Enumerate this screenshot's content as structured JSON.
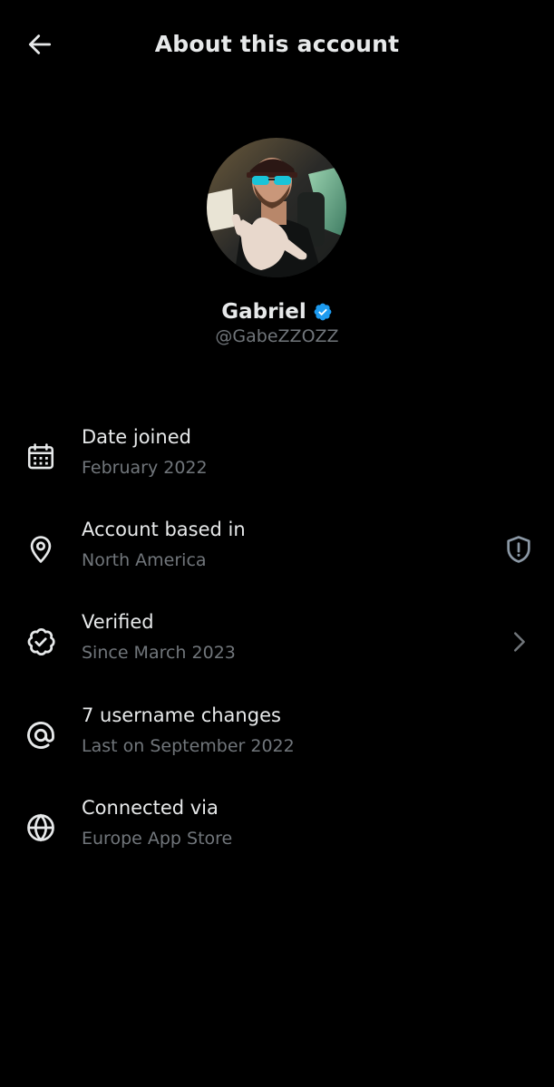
{
  "header": {
    "title": "About this account",
    "back_icon": "arrow-left-icon"
  },
  "profile": {
    "display_name": "Gabriel",
    "handle": "@GabeZZOZZ",
    "verified": true,
    "badge_color": "#1d9bf0"
  },
  "rows": [
    {
      "icon": "calendar-icon",
      "title": "Date joined",
      "subtitle": "February 2022"
    },
    {
      "icon": "location-pin-icon",
      "title": "Account based in",
      "subtitle": "North America",
      "trailing_icon": "shield-alert-icon"
    },
    {
      "icon": "verified-check-icon",
      "title": "Verified",
      "subtitle": "Since March 2023",
      "trailing_icon": "chevron-right-icon"
    },
    {
      "icon": "at-sign-icon",
      "title": "7 username changes",
      "subtitle": "Last on September 2022"
    },
    {
      "icon": "globe-icon",
      "title": "Connected via",
      "subtitle": "Europe App Store"
    }
  ],
  "colors": {
    "background": "#000000",
    "primary_text": "#e7e9ea",
    "secondary_text": "#71767b",
    "accent": "#1d9bf0"
  }
}
